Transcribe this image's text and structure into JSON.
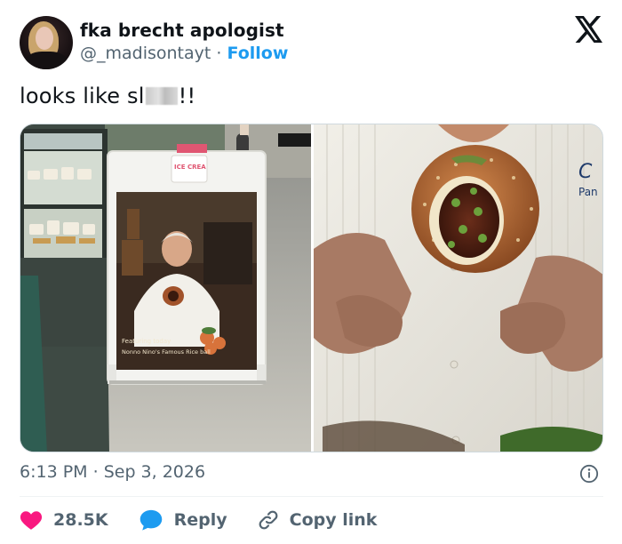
{
  "author": {
    "display_name": "fka brecht apologist",
    "handle": "@_madisontayt",
    "separator": "·",
    "follow_label": "Follow"
  },
  "icons": {
    "brand": "x-logo-icon",
    "info": "info-icon",
    "like": "heart-icon",
    "reply": "reply-bubble-icon",
    "copy": "link-icon"
  },
  "tweet": {
    "text_before": "looks like sl",
    "text_after": "!!"
  },
  "media": {
    "sign_cup_text": "ICE CREA",
    "sign_featuring": "Featuring today",
    "sign_subtitle": "Nonno Nino's Famous  Rice ball"
  },
  "meta": {
    "time": "6:13 PM",
    "separator": "·",
    "date": "Sep 3, 2026"
  },
  "actions": {
    "like_count": "28.5K",
    "reply_label": "Reply",
    "copy_label": "Copy link"
  },
  "colors": {
    "accent": "#1d9bf0",
    "like": "#f91880",
    "secondary_text": "#536471"
  }
}
